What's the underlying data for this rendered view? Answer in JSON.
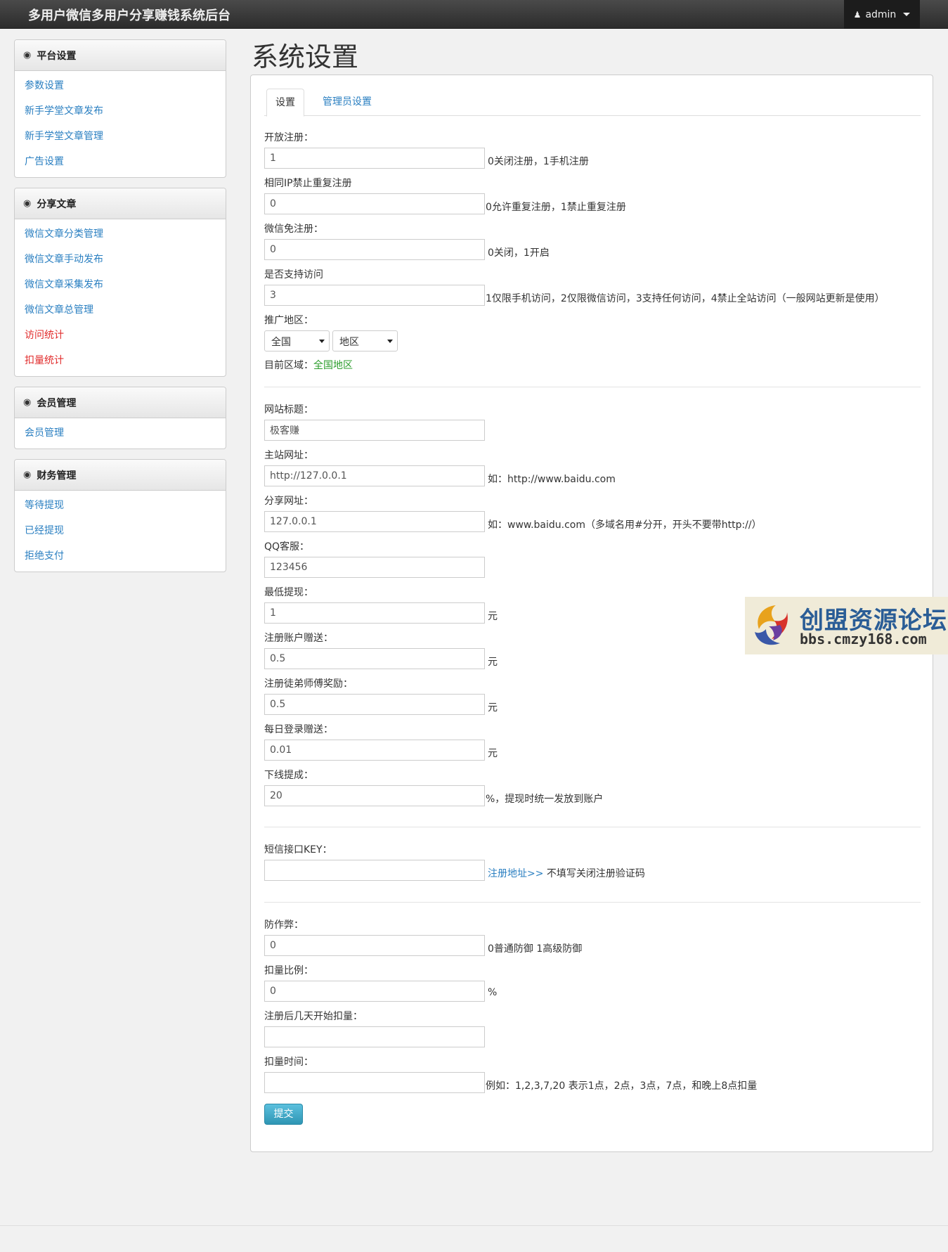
{
  "header": {
    "brand": "多用户微信多用户分享赚钱系统后台",
    "user": "admin"
  },
  "sidebar": {
    "groups": [
      {
        "title": "平台设置",
        "items": [
          {
            "label": "参数设置"
          },
          {
            "label": "新手学堂文章发布"
          },
          {
            "label": "新手学堂文章管理"
          },
          {
            "label": "广告设置"
          }
        ]
      },
      {
        "title": "分享文章",
        "items": [
          {
            "label": "微信文章分类管理"
          },
          {
            "label": "微信文章手动发布"
          },
          {
            "label": "微信文章采集发布"
          },
          {
            "label": "微信文章总管理"
          },
          {
            "label": "访问统计",
            "color": "#e12b2b"
          },
          {
            "label": "扣量统计",
            "color": "#e12b2b"
          }
        ]
      },
      {
        "title": "会员管理",
        "items": [
          {
            "label": "会员管理"
          }
        ]
      },
      {
        "title": "财务管理",
        "items": [
          {
            "label": "等待提现"
          },
          {
            "label": "已经提现"
          },
          {
            "label": "拒绝支付"
          }
        ]
      }
    ]
  },
  "main": {
    "page_title": "系统设置",
    "tabs": [
      {
        "label": "设置",
        "active": true
      },
      {
        "label": "管理员设置",
        "active": false
      }
    ],
    "fields": {
      "open_reg": {
        "label": "开放注册：",
        "value": "1",
        "hint": "0关闭注册，1手机注册"
      },
      "same_ip": {
        "label": "相同IP禁止重复注册",
        "value": "0",
        "hint": "0允许重复注册，1禁止重复注册"
      },
      "wx_free": {
        "label": "微信免注册：",
        "value": "0",
        "hint": "0关闭，1开启"
      },
      "access": {
        "label": "是否支持访问",
        "value": "3",
        "hint": "1仅限手机访问，2仅限微信访问，3支持任何访问，4禁止全站访问（一般网站更新是使用）"
      },
      "region": {
        "label": "推广地区：",
        "select1": "全国",
        "select2": "地区",
        "current_label": "目前区域：",
        "current_value": "全国地区"
      },
      "site_title": {
        "label": "网站标题：",
        "value": "极客赚"
      },
      "main_url": {
        "label": "主站网址：",
        "value": "http://127.0.0.1",
        "hint": "如：http://www.baidu.com"
      },
      "share_url": {
        "label": "分享网址：",
        "value": "127.0.0.1",
        "hint": "如：www.baidu.com（多域名用#分开，开头不要带http://）"
      },
      "qq": {
        "label": "QQ客服：",
        "value": "123456"
      },
      "min_withdraw": {
        "label": "最低提现：",
        "value": "1",
        "hint": "元"
      },
      "reg_gift": {
        "label": "注册账户赠送：",
        "value": "0.5",
        "hint": "元"
      },
      "apprentice": {
        "label": "注册徒弟师傅奖励：",
        "value": "0.5",
        "hint": "元"
      },
      "daily_login": {
        "label": "每日登录赠送：",
        "value": "0.01",
        "hint": "元"
      },
      "downline": {
        "label": "下线提成：",
        "value": "20",
        "hint": "%，提现时统一发放到账户"
      },
      "sms_key": {
        "label": "短信接口KEY：",
        "value": "",
        "hint_link": "注册地址>>",
        "hint": " 不填写关闭注册验证码"
      },
      "anti_cheat": {
        "label": "防作弊：",
        "value": "0",
        "hint": "0普通防御 1高级防御"
      },
      "deduct_ratio": {
        "label": "扣量比例：",
        "value": "0",
        "hint": "%"
      },
      "deduct_days": {
        "label": "注册后几天开始扣量：",
        "value": ""
      },
      "deduct_time": {
        "label": "扣量时间：",
        "value": "",
        "hint": "例如：1,2,3,7,20 表示1点，2点，3点，7点，和晚上8点扣量"
      }
    },
    "submit_label": "提交"
  },
  "watermark": {
    "title": "创盟资源论坛",
    "url": "bbs.cmzy168.com"
  }
}
